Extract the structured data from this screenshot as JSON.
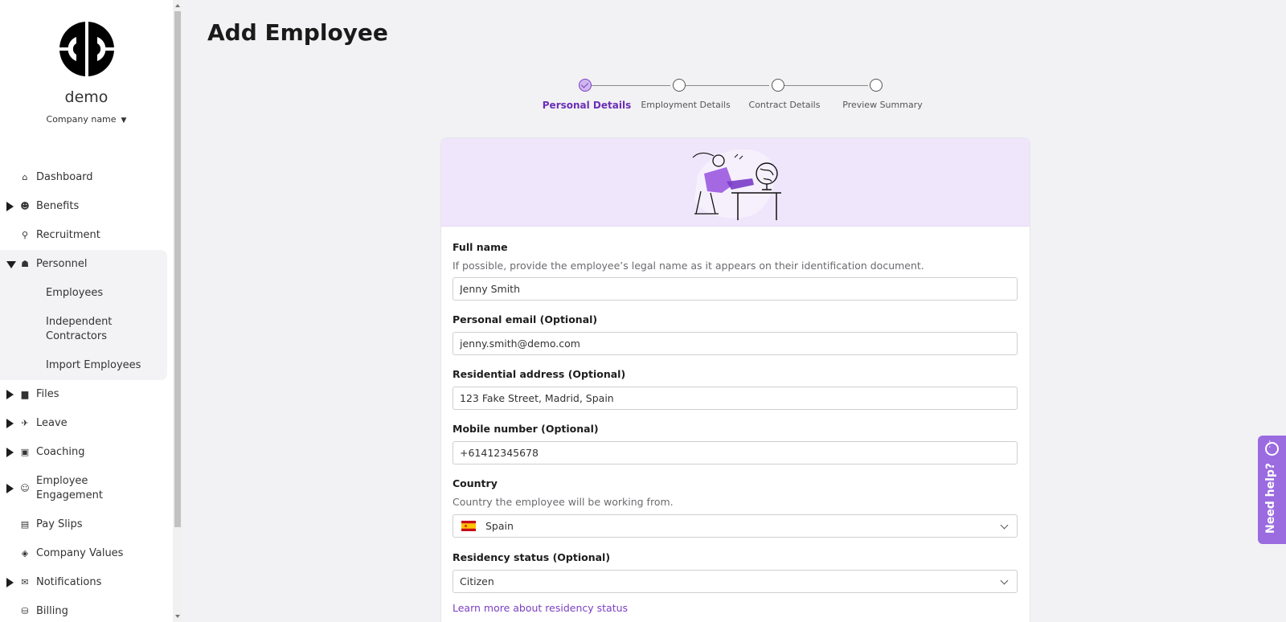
{
  "sidebar": {
    "org_name": "demo",
    "company_select_label": "Company name",
    "nav": {
      "dashboard": "Dashboard",
      "benefits": "Benefits",
      "recruitment": "Recruitment",
      "personnel": "Personnel",
      "employees": "Employees",
      "independent_contractors_line1": "Independent",
      "independent_contractors_line2": "Contractors",
      "import_employees": "Import Employees",
      "files": "Files",
      "leave": "Leave",
      "coaching": "Coaching",
      "employee_engagement_line1": "Employee",
      "employee_engagement_line2": "Engagement",
      "pay_slips": "Pay Slips",
      "company_values": "Company Values",
      "notifications": "Notifications",
      "billing": "Billing"
    }
  },
  "page": {
    "title": "Add Employee"
  },
  "stepper": {
    "steps": [
      "Personal Details",
      "Employment Details",
      "Contract Details",
      "Preview Summary"
    ],
    "active_index": 0
  },
  "form": {
    "full_name": {
      "label": "Full name",
      "help": "If possible, provide the employee’s legal name as it appears on their identification document.",
      "value": "Jenny Smith"
    },
    "personal_email": {
      "label": "Personal email (Optional)",
      "value": "jenny.smith@demo.com"
    },
    "residential_address": {
      "label": "Residential address (Optional)",
      "value": "123 Fake Street, Madrid, Spain"
    },
    "mobile_number": {
      "label": "Mobile number (Optional)",
      "value": "+61412345678"
    },
    "country": {
      "label": "Country",
      "help": "Country the employee will be working from.",
      "value": "Spain"
    },
    "residency_status": {
      "label": "Residency status (Optional)",
      "value": "Citizen",
      "learn_more": "Learn more about residency status"
    }
  },
  "help_tab": {
    "label": "Need help?"
  },
  "colors": {
    "accent": "#7b3fc4",
    "banner": "#efe6fb",
    "help_tab": "#9b6be0"
  }
}
